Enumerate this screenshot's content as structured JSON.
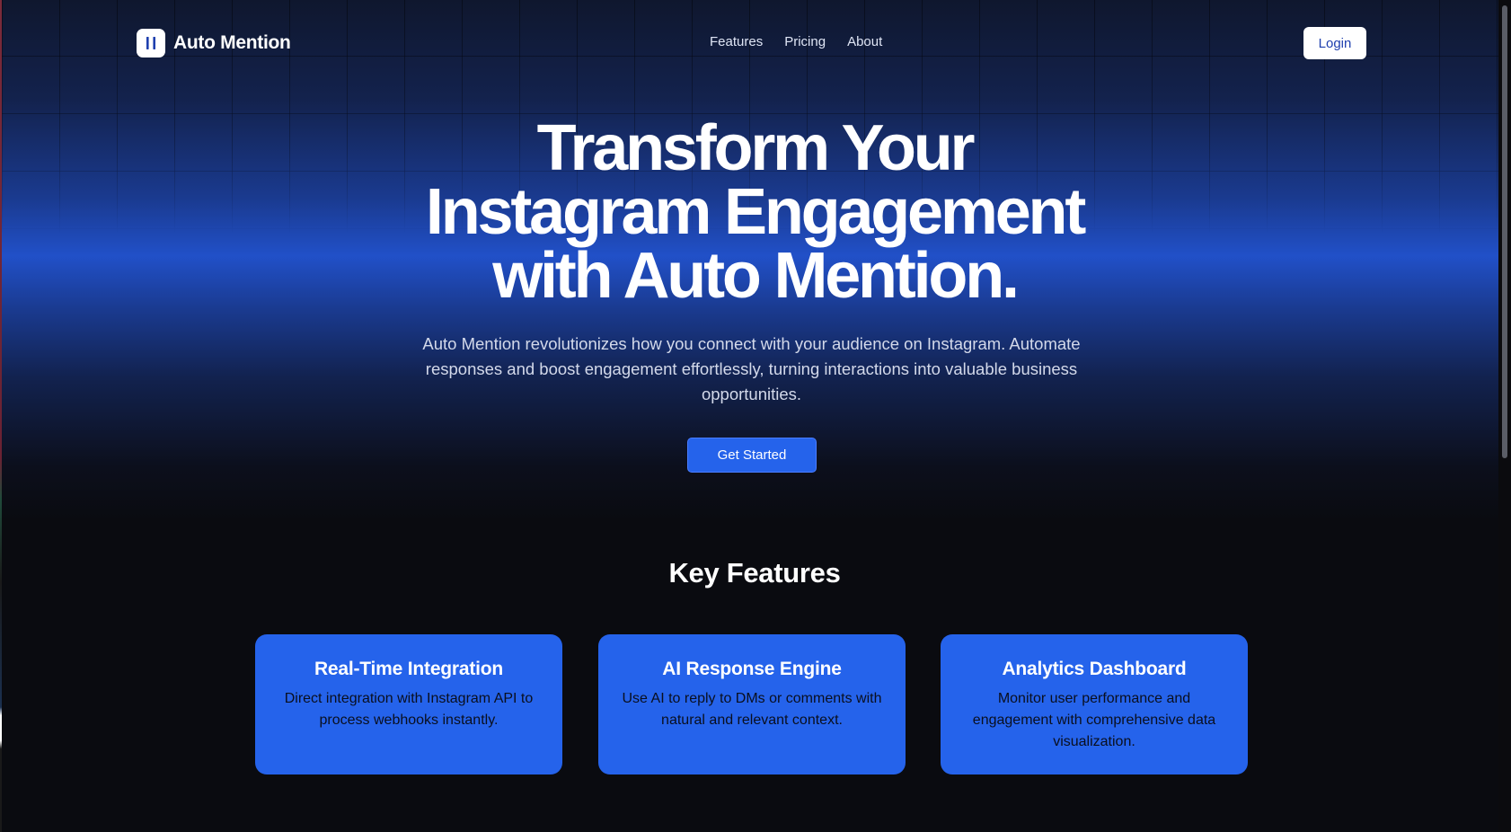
{
  "nav": {
    "brand_name": "Auto Mention",
    "brand_icon": "pause-bars-logo",
    "links": [
      "Features",
      "Pricing",
      "About"
    ],
    "login_label": "Login"
  },
  "hero": {
    "title_lines": [
      "Transform Your",
      "Instagram Engagement",
      "with Auto Mention."
    ],
    "subtitle": "Auto Mention revolutionizes how you connect with your audience on Instagram. Automate responses and boost engagement effortlessly, turning interactions into valuable business opportunities.",
    "cta_label": "Get Started"
  },
  "features": {
    "title": "Key Features",
    "cards": [
      {
        "title": "Real-Time Integration",
        "description": "Direct integration with Instagram API to process webhooks instantly."
      },
      {
        "title": "AI Response Engine",
        "description": "Use AI to reply to DMs or comments with natural and relevant context."
      },
      {
        "title": "Analytics Dashboard",
        "description": "Monitor user performance and engagement with comprehensive data visualization."
      }
    ]
  },
  "colors": {
    "accent": "#2563eb",
    "background": "#0a0b10",
    "login_text": "#1e3fae"
  }
}
